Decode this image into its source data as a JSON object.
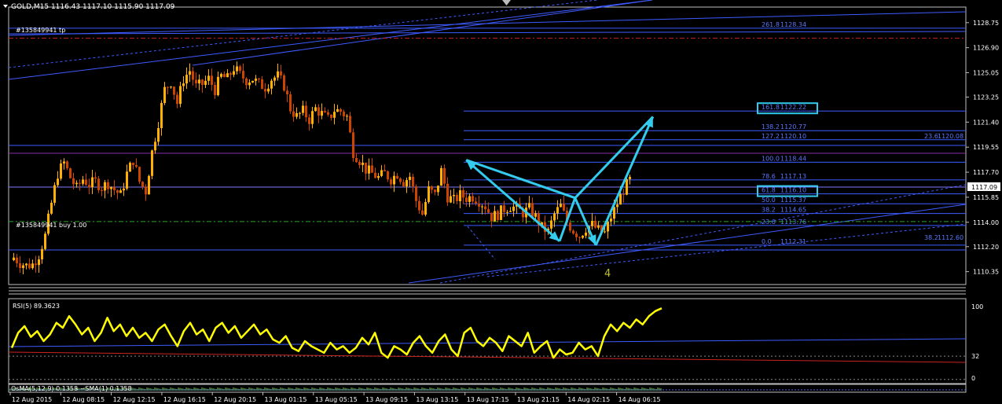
{
  "header": {
    "symbol_line": "GOLD,M15  1116.43 1117.10 1115.90 1117.09",
    "order_tp": "#135849941 tp",
    "order_buy": "#135849941 buy 1.00",
    "wave_label": "4",
    "price_tag": "1117.09"
  },
  "colors": {
    "background": "#000000",
    "bull_candle": "#FFB000",
    "bear_candle": "#CC4400",
    "fib_lines": "#3E5BFF",
    "fib_labels": "#5A78FF",
    "pattern": "#33CCEE",
    "rsi_line": "#FFFF00",
    "tp_line": "#CC2222",
    "buy_line": "#22AA22"
  },
  "chart_data": [
    {
      "type": "candlestick",
      "symbol": "GOLD",
      "timeframe": "M15",
      "ohlc_header": {
        "open": 1116.43,
        "high": 1117.1,
        "low": 1115.9,
        "close": 1117.09
      },
      "y_ticks": [
        1128.75,
        1126.9,
        1125.05,
        1123.25,
        1121.4,
        1119.55,
        1117.7,
        1115.85,
        1114.0,
        1112.2,
        1110.35
      ],
      "ylim": [
        1109.4,
        1129.9
      ],
      "x_ticks": [
        "12 Aug 2015",
        "12 Aug 08:15",
        "12 Aug 12:15",
        "12 Aug 16:15",
        "12 Aug 20:15",
        "13 Aug 01:15",
        "13 Aug 05:15",
        "13 Aug 09:15",
        "13 Aug 13:15",
        "13 Aug 17:15",
        "13 Aug 21:15",
        "14 Aug 02:15",
        "14 Aug 06:15"
      ],
      "close_path": [
        [
          0,
          1111.4
        ],
        [
          3,
          1111.0
        ],
        [
          5,
          1110.8
        ],
        [
          7,
          1110.9
        ],
        [
          9,
          1111.6
        ],
        [
          10,
          1113.0
        ],
        [
          11,
          1115.4
        ],
        [
          12,
          1117.6
        ],
        [
          13,
          1118.4
        ],
        [
          14,
          1117.3
        ],
        [
          15,
          1116.5
        ],
        [
          16,
          1117.2
        ],
        [
          17,
          1116.8
        ],
        [
          18,
          1117.0
        ],
        [
          19,
          1116.6
        ],
        [
          20,
          1116.9
        ],
        [
          21,
          1116.4
        ],
        [
          22,
          1116.0
        ],
        [
          23,
          1117.6
        ],
        [
          24,
          1118.6
        ],
        [
          25,
          1117.0
        ],
        [
          26,
          1116.3
        ],
        [
          27,
          1119.2
        ],
        [
          28,
          1121.4
        ],
        [
          29,
          1123.8
        ],
        [
          30,
          1124.4
        ],
        [
          31,
          1122.8
        ],
        [
          32,
          1124.6
        ],
        [
          33,
          1125.2
        ],
        [
          34,
          1124.0
        ],
        [
          35,
          1124.2
        ],
        [
          36,
          1124.6
        ],
        [
          37,
          1123.8
        ],
        [
          38,
          1124.8
        ],
        [
          39,
          1124.6
        ],
        [
          40,
          1125.4
        ],
        [
          41,
          1124.9
        ],
        [
          42,
          1124.5
        ],
        [
          43,
          1124.6
        ],
        [
          44,
          1124.2
        ],
        [
          45,
          1124.0
        ],
        [
          46,
          1124.6
        ],
        [
          47,
          1124.8
        ],
        [
          48,
          1124.1
        ],
        [
          49,
          1122.4
        ],
        [
          50,
          1121.8
        ],
        [
          51,
          1122.2
        ],
        [
          52,
          1121.6
        ],
        [
          53,
          1122.4
        ],
        [
          54,
          1122.0
        ],
        [
          55,
          1121.6
        ],
        [
          56,
          1122.3
        ],
        [
          57,
          1122.2
        ],
        [
          58,
          1121.8
        ],
        [
          59,
          1119.2
        ],
        [
          60,
          1118.6
        ],
        [
          61,
          1117.9
        ],
        [
          62,
          1117.6
        ],
        [
          63,
          1117.3
        ],
        [
          64,
          1117.6
        ],
        [
          65,
          1117.2
        ],
        [
          66,
          1117.6
        ],
        [
          67,
          1117.0
        ],
        [
          68,
          1117.4
        ],
        [
          69,
          1115.6
        ],
        [
          70,
          1114.6
        ],
        [
          71,
          1116.4
        ],
        [
          72,
          1116.0
        ],
        [
          73,
          1117.8
        ],
        [
          74,
          1115.9
        ],
        [
          75,
          1115.6
        ],
        [
          76,
          1116.0
        ],
        [
          77,
          1115.8
        ],
        [
          78,
          1115.9
        ],
        [
          79,
          1115.6
        ],
        [
          80,
          1115.2
        ],
        [
          81,
          1114.4
        ],
        [
          82,
          1114.6
        ],
        [
          83,
          1115.0
        ],
        [
          84,
          1115.2
        ],
        [
          85,
          1115.0
        ],
        [
          86,
          1114.7
        ],
        [
          87,
          1115.0
        ],
        [
          88,
          1114.4
        ],
        [
          89,
          1113.6
        ],
        [
          90,
          1113.3
        ],
        [
          91,
          1114.6
        ],
        [
          92,
          1115.2
        ],
        [
          93,
          1114.0
        ],
        [
          94,
          1113.4
        ],
        [
          95,
          1113.0
        ],
        [
          96,
          1113.6
        ],
        [
          97,
          1113.8
        ],
        [
          98,
          1113.4
        ],
        [
          99,
          1113.2
        ],
        [
          100,
          1114.4
        ],
        [
          101,
          1115.4
        ],
        [
          102,
          1116.4
        ],
        [
          103,
          1117.1
        ]
      ],
      "fibonacci_retracement": [
        {
          "level": "261.8",
          "price": "1128.34"
        },
        {
          "level": "161.8",
          "price": "1122.22"
        },
        {
          "level": "138.2",
          "price": "1120.77"
        },
        {
          "level": "127.2",
          "price": "1120.10"
        },
        {
          "level": "100.0",
          "price": "1118.44"
        },
        {
          "level": "78.6",
          "price": "1117.13"
        },
        {
          "level": "61.8",
          "price": "1116.10"
        },
        {
          "level": "50.0",
          "price": "1115.37"
        },
        {
          "level": "38.2",
          "price": "1114.65"
        },
        {
          "level": "23.6",
          "price": "1113.76"
        },
        {
          "level": "0.0",
          "price": "1112.31"
        }
      ],
      "other_fib_labels": [
        {
          "level": "23.6",
          "price": "1120.08"
        },
        {
          "level": "38.2",
          "price": "1112.60"
        }
      ],
      "boxed_levels": [
        "161.8",
        "61.8"
      ],
      "order_levels": {
        "take_profit": 1127.6,
        "buy": 1114.05
      },
      "pattern_points": [
        [
          82,
          1118.6
        ],
        [
          100,
          1112.6
        ],
        [
          103,
          1115.8
        ],
        [
          107,
          1112.3
        ],
        [
          118,
          1121.8
        ]
      ]
    },
    {
      "type": "line",
      "indicator": "RSI",
      "title": "RSI(5) 89.3623",
      "period": 5,
      "last_value": 89.3623,
      "y_ticks": [
        100,
        32,
        0
      ],
      "ylim": [
        0,
        100
      ],
      "values": [
        42,
        60,
        68,
        55,
        62,
        50,
        58,
        72,
        66,
        80,
        70,
        58,
        66,
        50,
        60,
        78,
        62,
        70,
        56,
        66,
        54,
        60,
        50,
        64,
        70,
        56,
        44,
        62,
        72,
        58,
        64,
        50,
        66,
        72,
        60,
        68,
        54,
        62,
        70,
        58,
        64,
        52,
        48,
        56,
        42,
        38,
        50,
        44,
        40,
        36,
        48,
        40,
        44,
        36,
        42,
        54,
        46,
        60,
        36,
        30,
        44,
        40,
        34,
        48,
        56,
        44,
        36,
        50,
        58,
        40,
        32,
        60,
        66,
        50,
        44,
        54,
        48,
        38,
        56,
        50,
        44,
        60,
        36,
        44,
        50,
        30,
        40,
        34,
        36,
        48,
        40,
        44,
        32,
        56,
        70,
        62,
        72,
        66,
        76,
        70,
        80,
        86,
        89.4
      ]
    },
    {
      "type": "line",
      "indicator": "OsMA",
      "title": "OsMA(5,12,9) 0.1358 ~SMA(1) 0.1358",
      "values": [
        0.1,
        0.2,
        0.1,
        0.3,
        0.2,
        0.1,
        0.2,
        0.3,
        0.2,
        0.1,
        0.2,
        0.1358
      ]
    }
  ]
}
